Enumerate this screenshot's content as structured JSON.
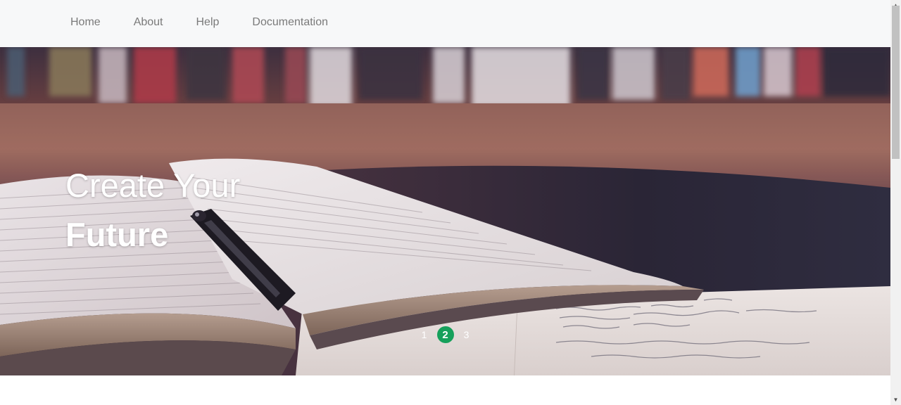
{
  "nav": {
    "items": [
      {
        "label": "Home"
      },
      {
        "label": "About"
      },
      {
        "label": "Help"
      },
      {
        "label": "Documentation"
      }
    ]
  },
  "hero": {
    "title_line1": "Create Your",
    "title_line2": "Future",
    "background_description_icon": "open-book-with-pen-image"
  },
  "pager": {
    "items": [
      "1",
      "2",
      "3"
    ],
    "active": "2",
    "active_color": "#16a05b"
  },
  "colors": {
    "navbar_bg": "#f7f8f9",
    "nav_text": "#7a7a7a",
    "hero_text": "#ffffff"
  }
}
